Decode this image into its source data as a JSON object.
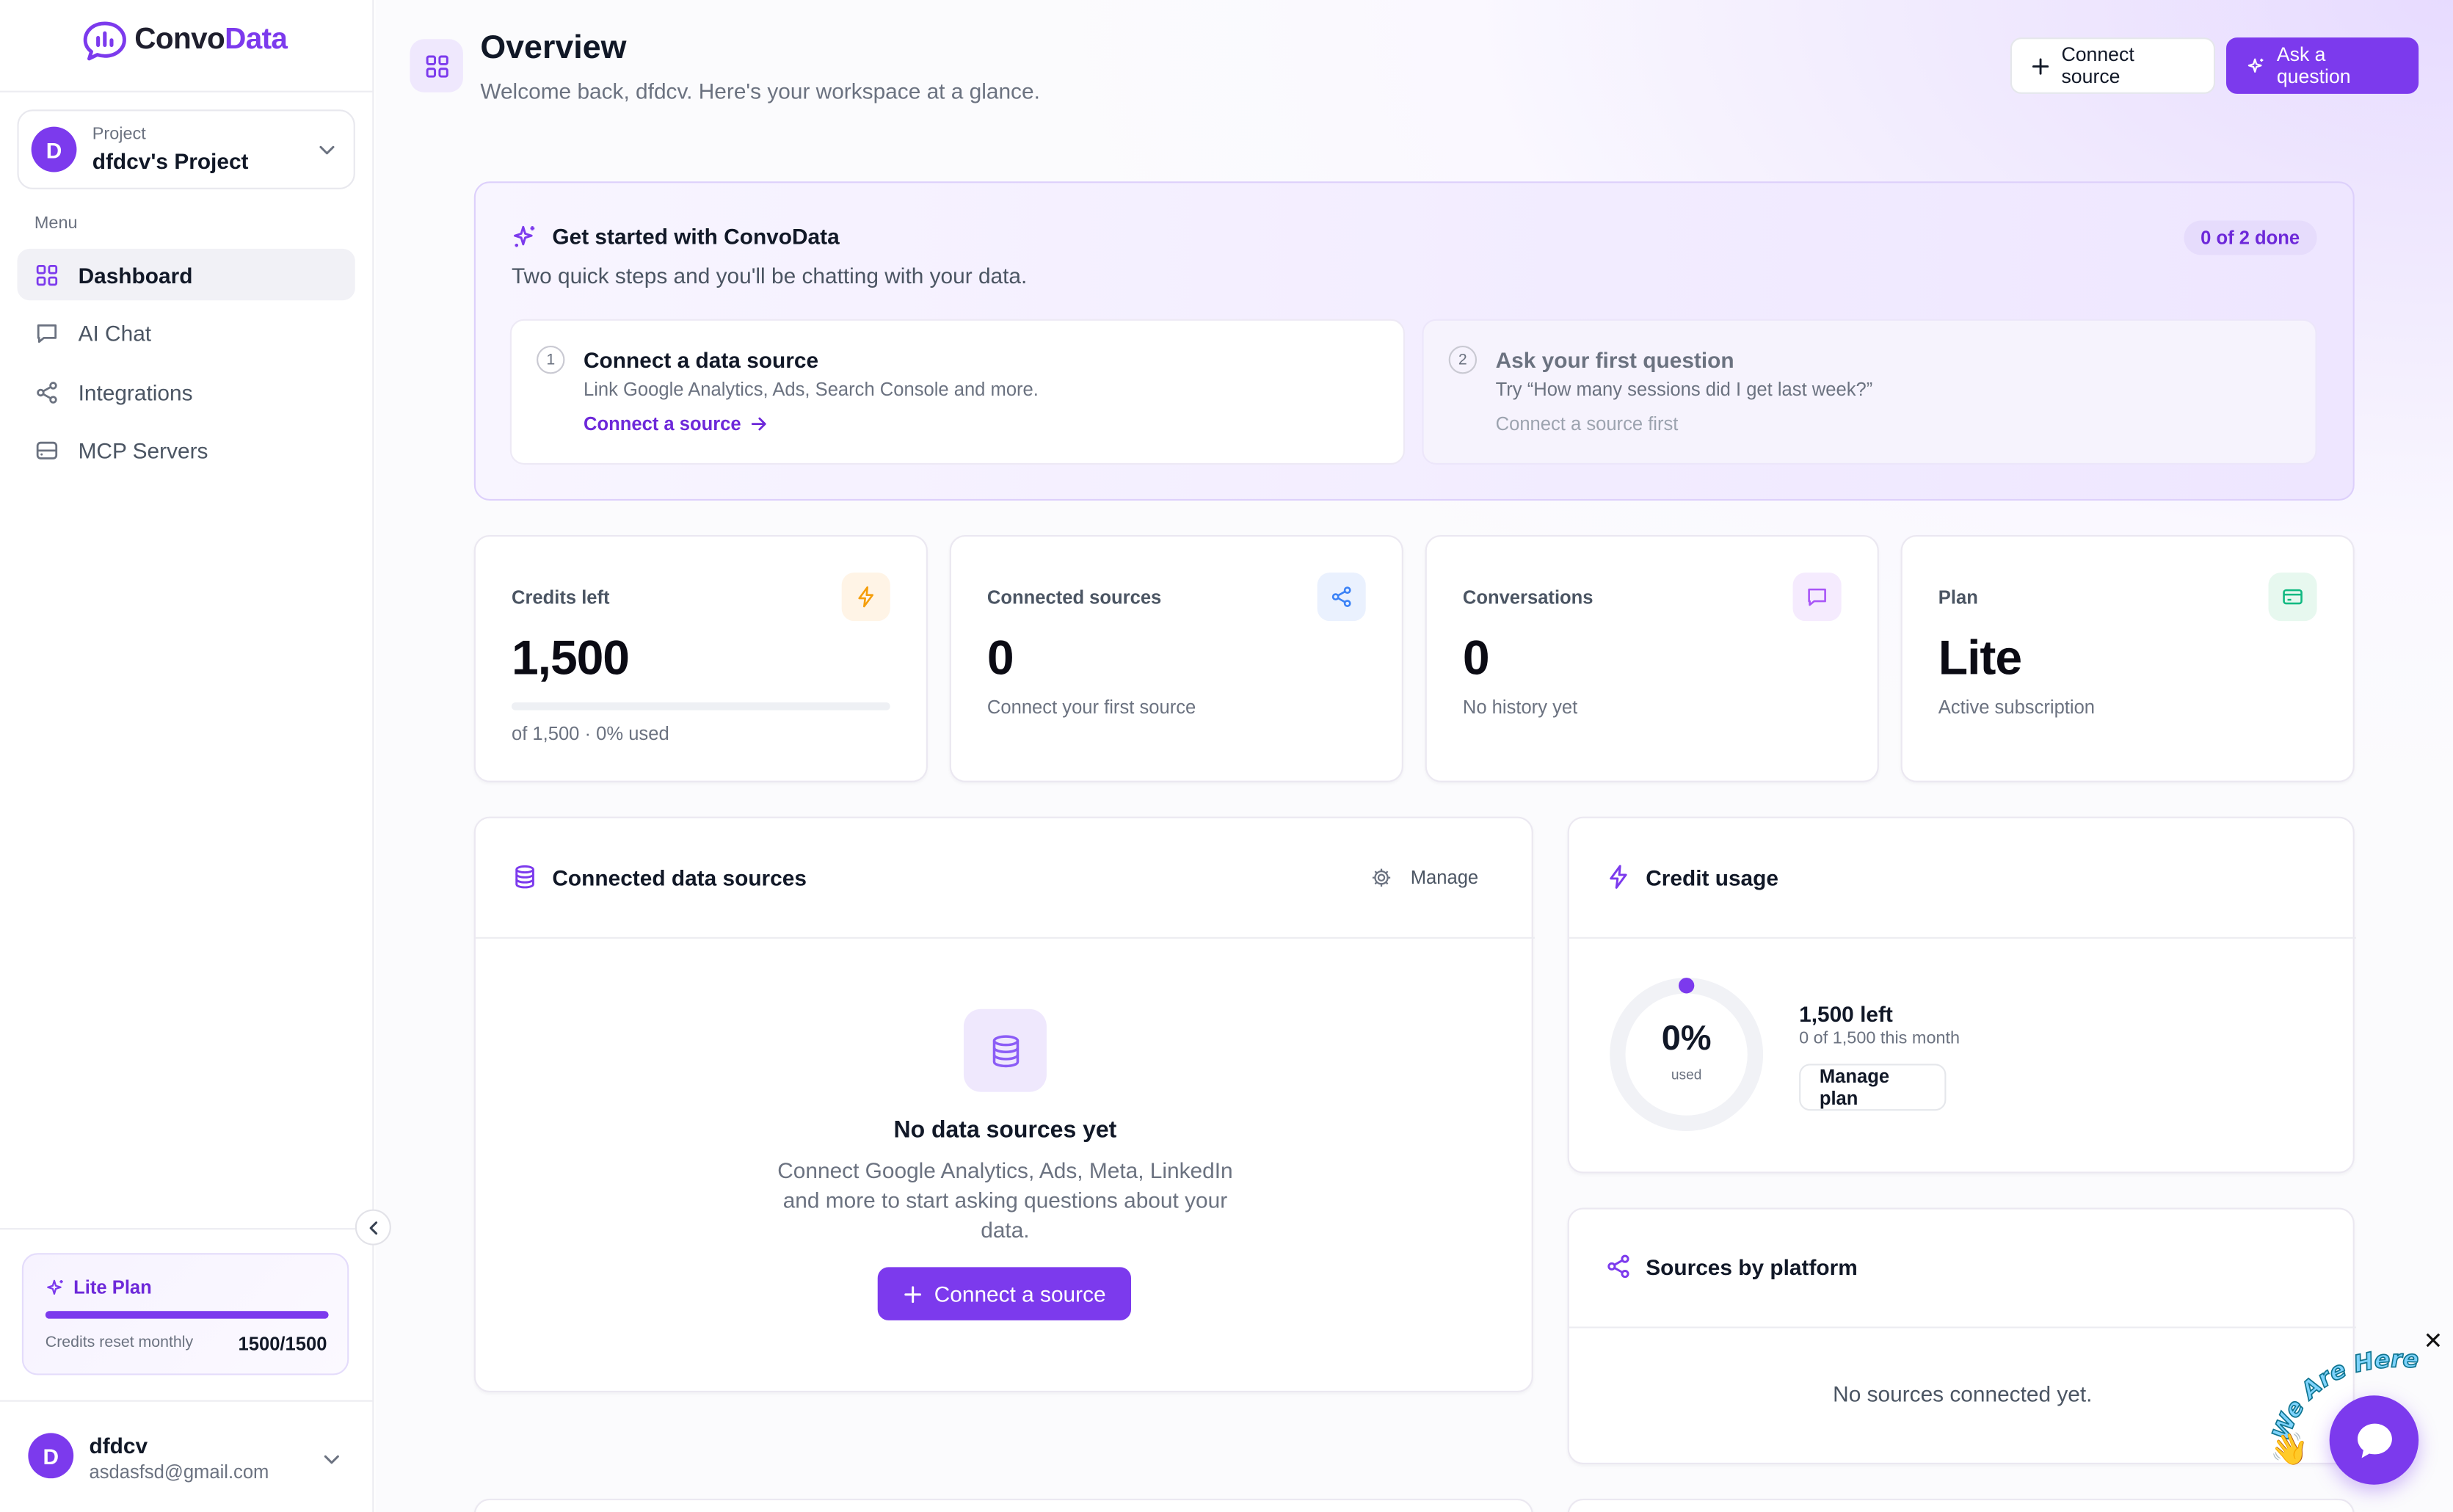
{
  "brand": {
    "name_a": "Convo",
    "name_b": "Data",
    "accent": "#7c3aed"
  },
  "sidebar": {
    "project": {
      "kicker": "Project",
      "name": "dfdcv's Project",
      "initial": "D"
    },
    "menu_label": "Menu",
    "items": [
      {
        "label": "Dashboard",
        "icon": "grid-icon",
        "active": true
      },
      {
        "label": "AI Chat",
        "icon": "chat-icon",
        "active": false
      },
      {
        "label": "Integrations",
        "icon": "share-icon",
        "active": false
      },
      {
        "label": "MCP Servers",
        "icon": "server-icon",
        "active": false
      }
    ],
    "plan": {
      "title": "Lite Plan",
      "reset_label": "Credits reset monthly",
      "count": "1500/1500",
      "fraction_remaining": 1.0
    },
    "user": {
      "initial": "D",
      "name": "dfdcv",
      "email": "asdasfsd@gmail.com"
    }
  },
  "header": {
    "title": "Overview",
    "subtitle": "Welcome back, dfdcv. Here's your workspace at a glance.",
    "connect_label": "Connect source",
    "ask_label": "Ask a question"
  },
  "get_started": {
    "title": "Get started with ConvoData",
    "subtitle": "Two quick steps and you'll be chatting with your data.",
    "badge": "0 of 2 done",
    "steps": [
      {
        "num": "1",
        "title": "Connect a data source",
        "desc": "Link Google Analytics, Ads, Search Console and more.",
        "action": "Connect a source"
      },
      {
        "num": "2",
        "title": "Ask your first question",
        "desc": "Try “How many sessions did I get last week?”",
        "action": "Connect a source first"
      }
    ]
  },
  "stats": {
    "credits": {
      "label": "Credits left",
      "value": "1,500",
      "sub": "of 1,500 · 0% used",
      "used_fraction": 0.0
    },
    "sources": {
      "label": "Connected sources",
      "value": "0",
      "sub": "Connect your first source"
    },
    "conversations": {
      "label": "Conversations",
      "value": "0",
      "sub": "No history yet"
    },
    "plan": {
      "label": "Plan",
      "value": "Lite",
      "sub": "Active subscription"
    }
  },
  "connected_sources": {
    "title": "Connected data sources",
    "manage": "Manage",
    "empty_title": "No data sources yet",
    "empty_desc": "Connect Google Analytics, Ads, Meta, LinkedIn and more to start asking questions about your data.",
    "cta": "Connect a source"
  },
  "credit_usage": {
    "title": "Credit usage",
    "percent": "0%",
    "used_label": "used",
    "left": "1,500 left",
    "month": "0 of 1,500 this month",
    "manage_plan": "Manage plan",
    "used_fraction": 0.0
  },
  "sources_by_platform": {
    "title": "Sources by platform",
    "empty": "No sources connected yet."
  },
  "chat_widget": {
    "sticker_text": "We Are Here!",
    "close": "✕"
  }
}
